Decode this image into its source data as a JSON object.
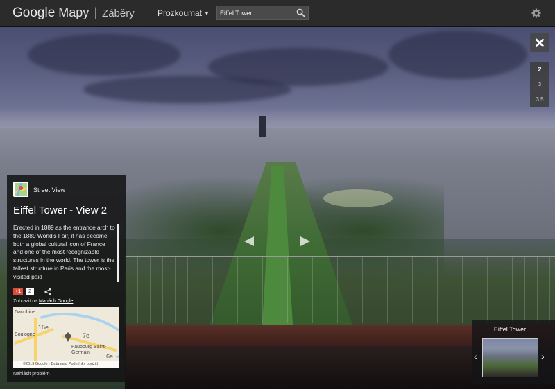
{
  "header": {
    "logo_google": "Google",
    "logo_maps": "Mapy",
    "logo_sub": "Záběry",
    "explore_label": "Prozkoumat",
    "search_value": "Eiffel Tower",
    "icons": {
      "search": "search-icon",
      "settings": "gear-icon",
      "explore_caret": "caret-down-icon"
    }
  },
  "controls": {
    "close_label": "✕",
    "zoom_levels": [
      "2",
      "3",
      "3.5"
    ],
    "zoom_selected": "2"
  },
  "info_panel": {
    "type_label": "Street View",
    "title": "Eiffel Tower - View 2",
    "description": "Erected in 1889 as the entrance arch to the 1889 World's Fair, it has become both a global cultural icon of France and one of the most recognizable structures in the world. The tower is the tallest structure in Paris and the most-visited paid",
    "gplus_label": "+1",
    "gplus_count": "2",
    "view_on_prefix": "Zobrazit na",
    "view_on_link": "Mapách Google",
    "map": {
      "labels": [
        "Dauphine",
        "16e",
        "Boulogne",
        "Faubourg Saint-Germain",
        "7e",
        "6e"
      ],
      "copyright": "©2013 Google · Data map   Podmínky použití"
    },
    "report_label": "Nahlásit problém"
  },
  "thumbnail": {
    "title": "Eiffel Tower",
    "prev_label": "‹",
    "next_label": "›"
  },
  "colors": {
    "topbar": "#2b2b2b",
    "panel": "#141416",
    "gplus": "#dd4b39"
  }
}
